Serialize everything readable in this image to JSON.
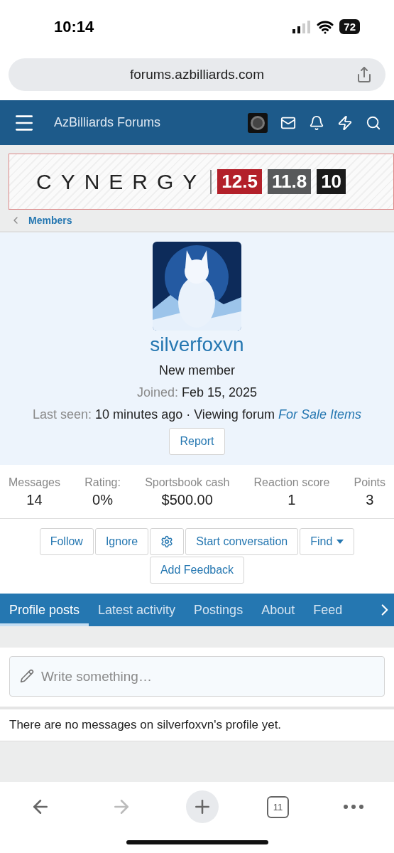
{
  "status_bar": {
    "time": "10:14",
    "battery": "72"
  },
  "address_bar": {
    "url": "forums.azbilliards.com"
  },
  "nav": {
    "title": "AzBilliards Forums"
  },
  "ad_banner": {
    "brand": "CYNERGY",
    "badges": [
      {
        "text": "12.5",
        "color": "#b3202a"
      },
      {
        "text": "11.8",
        "color": "#58595b"
      },
      {
        "text": "10",
        "color": "#1a1a1a"
      }
    ]
  },
  "breadcrumb": {
    "label": "Members"
  },
  "profile": {
    "username": "silverfoxvn",
    "title": "New member",
    "joined_label": "Joined:",
    "joined": "Feb 15, 2025",
    "last_seen_label": "Last seen:",
    "last_seen": "10 minutes ago · Viewing forum",
    "last_seen_link": "For Sale Items",
    "report": "Report"
  },
  "stats": [
    {
      "label": "Messages",
      "value": "14"
    },
    {
      "label": "Rating:",
      "value": "0%"
    },
    {
      "label": "Sportsbook cash",
      "value": "$500.00"
    },
    {
      "label": "Reaction score",
      "value": "1"
    },
    {
      "label": "Points",
      "value": "3"
    }
  ],
  "actions": [
    {
      "kind": "text",
      "label": "Follow"
    },
    {
      "kind": "text",
      "label": "Ignore"
    },
    {
      "kind": "gear"
    },
    {
      "kind": "text",
      "label": "Start conversation"
    },
    {
      "kind": "menu",
      "label": "Find"
    },
    {
      "kind": "text",
      "label": "Add Feedback"
    }
  ],
  "tabs": [
    {
      "label": "Profile posts",
      "selected": true
    },
    {
      "label": "Latest activity",
      "selected": false
    },
    {
      "label": "Postings",
      "selected": false
    },
    {
      "label": "About",
      "selected": false
    },
    {
      "label": "Feed",
      "selected": false
    }
  ],
  "composer": {
    "placeholder": "Write something…"
  },
  "empty_message": "There are no messages on silverfoxvn's profile yet.",
  "browser_toolbar": {
    "back_disabled": false,
    "forward_disabled": true,
    "tab_count": "11"
  }
}
